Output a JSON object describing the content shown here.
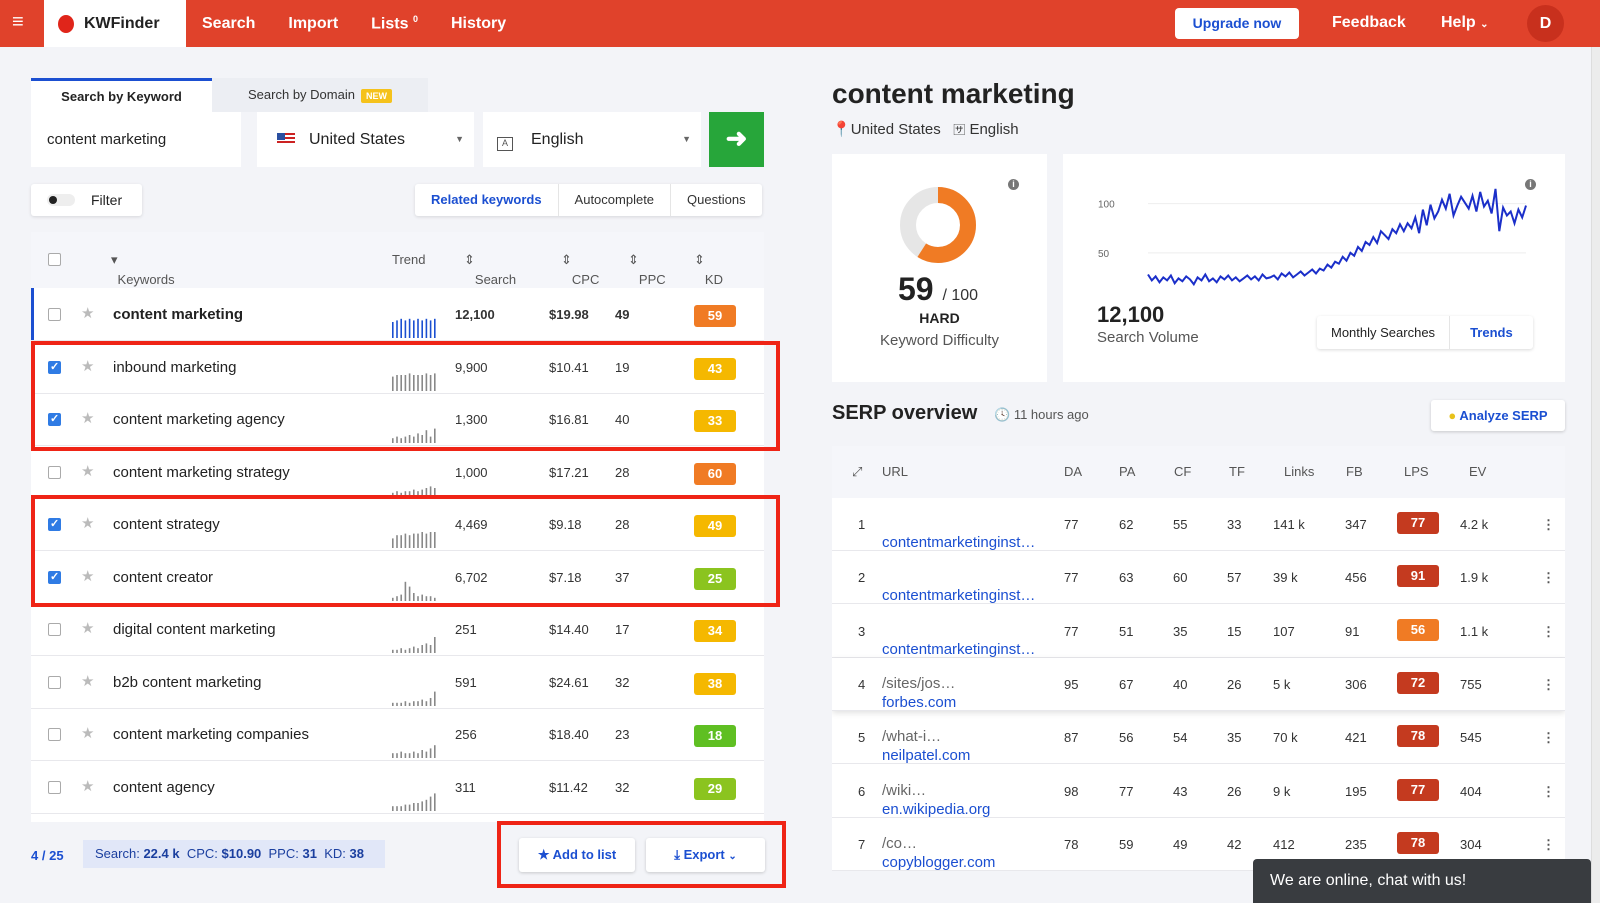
{
  "topbar": {
    "brand": "KWFinder",
    "nav": [
      "Search",
      "Import",
      "Lists",
      "History"
    ],
    "lists_badge": "0",
    "upgrade": "Upgrade now",
    "feedback": "Feedback",
    "help": "Help",
    "avatar": "D"
  },
  "search": {
    "tab_keyword": "Search by Keyword",
    "tab_domain": "Search by Domain",
    "new_badge": "NEW",
    "keyword": "content marketing",
    "country": "United States",
    "language": "English",
    "filter_label": "Filter",
    "kw_tabs": [
      "Related keywords",
      "Autocomplete",
      "Questions"
    ]
  },
  "keywords_table": {
    "headers": {
      "keywords": "Keywords",
      "trend": "Trend",
      "search": "Search",
      "cpc": "CPC",
      "ppc": "PPC",
      "kd": "KD"
    },
    "rows": [
      {
        "keyword": "content marketing",
        "search": "12,100",
        "cpc": "$19.98",
        "ppc": "49",
        "kd": "59",
        "checked": false
      },
      {
        "keyword": "inbound marketing",
        "search": "9,900",
        "cpc": "$10.41",
        "ppc": "19",
        "kd": "43",
        "checked": true
      },
      {
        "keyword": "content marketing agency",
        "search": "1,300",
        "cpc": "$16.81",
        "ppc": "40",
        "kd": "33",
        "checked": true
      },
      {
        "keyword": "content marketing strategy",
        "search": "1,000",
        "cpc": "$17.21",
        "ppc": "28",
        "kd": "60",
        "checked": false
      },
      {
        "keyword": "content strategy",
        "search": "4,469",
        "cpc": "$9.18",
        "ppc": "28",
        "kd": "49",
        "checked": true
      },
      {
        "keyword": "content creator",
        "search": "6,702",
        "cpc": "$7.18",
        "ppc": "37",
        "kd": "25",
        "checked": true
      },
      {
        "keyword": "digital content marketing",
        "search": "251",
        "cpc": "$14.40",
        "ppc": "17",
        "kd": "34",
        "checked": false
      },
      {
        "keyword": "b2b content marketing",
        "search": "591",
        "cpc": "$24.61",
        "ppc": "32",
        "kd": "38",
        "checked": false
      },
      {
        "keyword": "content marketing companies",
        "search": "256",
        "cpc": "$18.40",
        "ppc": "23",
        "kd": "18",
        "checked": false
      },
      {
        "keyword": "content agency",
        "search": "311",
        "cpc": "$11.42",
        "ppc": "32",
        "kd": "29",
        "checked": false
      }
    ]
  },
  "footer": {
    "selected": "4",
    "total": "/ 25",
    "search_label": "Search:",
    "search_val": "22.4 k",
    "cpc_label": "CPC:",
    "cpc_val": "$10.90",
    "ppc_label": "PPC:",
    "ppc_val": "31",
    "kd_label": "KD:",
    "kd_val": "38",
    "add_to_list": "Add to list",
    "export": "Export"
  },
  "detail": {
    "title": "content marketing",
    "country": "United States",
    "language": "English",
    "kd_value": "59",
    "kd_max": "/ 100",
    "kd_level": "HARD",
    "kd_label": "Keyword Difficulty",
    "volume": "12,100",
    "volume_label": "Search Volume",
    "chart_tabs": [
      "Monthly Searches",
      "Trends"
    ]
  },
  "chart_data": {
    "type": "line",
    "title": "",
    "yticks": [
      100,
      50
    ],
    "ylim": [
      0,
      120
    ],
    "series": [
      {
        "values": [
          28,
          22,
          26,
          20,
          25,
          22,
          27,
          19,
          24,
          21,
          26,
          23,
          18,
          25,
          22,
          28,
          21,
          24,
          20,
          26,
          23,
          27,
          22,
          25,
          21,
          24,
          27,
          23,
          26,
          22,
          28,
          24,
          25,
          27,
          23,
          29,
          26,
          30,
          25,
          28,
          31,
          27,
          30,
          33,
          29,
          34,
          32,
          38,
          35,
          41,
          39,
          46,
          42,
          50,
          47,
          56,
          52,
          61,
          58,
          66,
          60,
          72,
          68,
          64,
          74,
          70,
          79,
          72,
          80,
          75,
          86,
          70,
          94,
          78,
          99,
          85,
          92,
          104,
          95,
          110,
          88,
          98,
          107,
          101,
          95,
          108,
          92,
          112,
          97,
          103,
          90,
          115,
          72,
          96,
          88,
          92,
          80,
          94,
          86,
          98
        ]
      }
    ]
  },
  "serp": {
    "title": "SERP overview",
    "time": "11 hours ago",
    "analyze": "Analyze SERP",
    "headers": [
      "URL",
      "DA",
      "PA",
      "CF",
      "TF",
      "Links",
      "FB",
      "LPS",
      "EV"
    ],
    "rows": [
      {
        "rank": "1",
        "domain": "contentmarketinginst…",
        "path": "",
        "da": "77",
        "pa": "62",
        "cf": "55",
        "tf": "33",
        "links": "141 k",
        "fb": "347",
        "lps": "77",
        "ev": "4.2 k"
      },
      {
        "rank": "2",
        "domain": "contentmarketinginst…",
        "path": "",
        "da": "77",
        "pa": "63",
        "cf": "60",
        "tf": "57",
        "links": "39 k",
        "fb": "456",
        "lps": "91",
        "ev": "1.9 k"
      },
      {
        "rank": "3",
        "domain": "contentmarketinginst…",
        "path": "",
        "da": "77",
        "pa": "51",
        "cf": "35",
        "tf": "15",
        "links": "107",
        "fb": "91",
        "lps": "56",
        "ev": "1.1 k"
      },
      {
        "rank": "4",
        "domain": "forbes.com",
        "path": "/sites/jos…",
        "da": "95",
        "pa": "67",
        "cf": "40",
        "tf": "26",
        "links": "5 k",
        "fb": "306",
        "lps": "72",
        "ev": "755"
      },
      {
        "rank": "5",
        "domain": "neilpatel.com",
        "path": "/what-i…",
        "da": "87",
        "pa": "56",
        "cf": "54",
        "tf": "35",
        "links": "70 k",
        "fb": "421",
        "lps": "78",
        "ev": "545"
      },
      {
        "rank": "6",
        "domain": "en.wikipedia.org",
        "path": "/wiki…",
        "da": "98",
        "pa": "77",
        "cf": "43",
        "tf": "26",
        "links": "9 k",
        "fb": "195",
        "lps": "77",
        "ev": "404"
      },
      {
        "rank": "7",
        "domain": "copyblogger.com",
        "path": "/co…",
        "da": "78",
        "pa": "59",
        "cf": "49",
        "tf": "42",
        "links": "412",
        "fb": "235",
        "lps": "78",
        "ev": "304"
      }
    ]
  },
  "chat": "We are online, chat with us!"
}
